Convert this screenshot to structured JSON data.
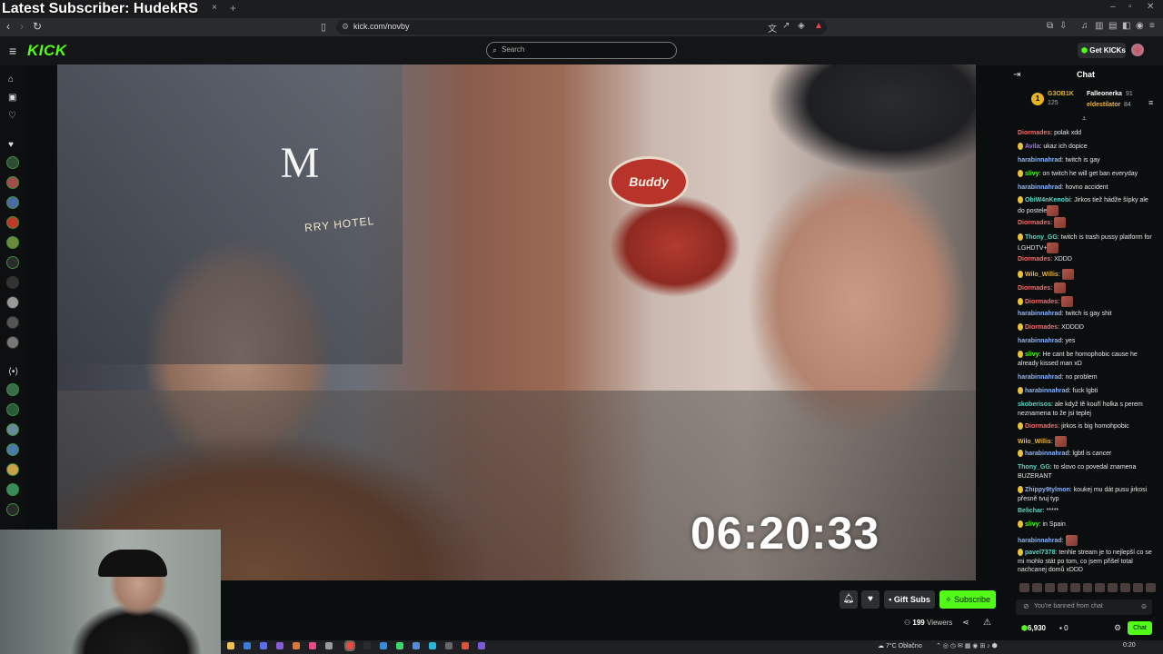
{
  "overlay": {
    "title": "Latest Subscriber: HudekRS"
  },
  "browser": {
    "url": "kick.com/novby",
    "tab_close": "×",
    "tab_new": "+"
  },
  "topnav": {
    "logo": "KICK",
    "search_placeholder": "Search",
    "get_kicks": "Get KICKs"
  },
  "video": {
    "timer": "06:20:33",
    "sign_text": "Buddy",
    "hotel_letter": "M",
    "hotel_name": "RRY HOTEL"
  },
  "controls": {
    "gift_subs": "Gift Subs",
    "subscribe": "Subscribe",
    "viewers_count": "199",
    "viewers_label": "Viewers"
  },
  "chat": {
    "title": "Chat",
    "leaderboard": {
      "rank": "1",
      "first_name": "G3OB1K",
      "first_value": "125",
      "second_name": "Falleonerka",
      "second_value": "91",
      "third_name": "eldestilator",
      "third_value": "84"
    },
    "messages": [
      {
        "user": "Diormades",
        "color": "#ff6b6b",
        "text": "polak xdd",
        "emote": false
      },
      {
        "user": "Avila",
        "color": "#b16cff",
        "text": "ukaz ich dopice",
        "emote": false
      },
      {
        "user": "harabinnahrad",
        "color": "#8ab4f8",
        "text": "twitch is gay",
        "emote": false
      },
      {
        "user": "slivy",
        "color": "#53fc18",
        "text": "on twitch he will get ban everyday",
        "emote": false
      },
      {
        "user": "harabinnahrad",
        "color": "#8ab4f8",
        "text": "hovno accident",
        "emote": false
      },
      {
        "user": "ObiW4nKenobi",
        "color": "#5ad8c7",
        "text": "Jirkos tiež hádže šípky ale do postele",
        "emote": true
      },
      {
        "user": "Diormades",
        "color": "#ff6b6b",
        "text": "",
        "emote": true
      },
      {
        "user": "Thony_GG",
        "color": "#5ad8c7",
        "text": "twitch is trash pussy platform for LGHDTV+",
        "emote": true
      },
      {
        "user": "Diormades",
        "color": "#ff6b6b",
        "text": "XDDD",
        "emote": false
      },
      {
        "user": "Wilo_Willis",
        "color": "#f3b23a",
        "text": "",
        "emote": true
      },
      {
        "user": "Diormades",
        "color": "#ff6b6b",
        "text": "",
        "emote": true
      },
      {
        "user": "Diormades",
        "color": "#ff6b6b",
        "text": "",
        "emote": true
      },
      {
        "user": "harabinnahrad",
        "color": "#8ab4f8",
        "text": "twitch is gay shit",
        "emote": false
      },
      {
        "user": "Diormades",
        "color": "#ff6b6b",
        "text": "XDDDD",
        "emote": false
      },
      {
        "user": "harabinnahrad",
        "color": "#8ab4f8",
        "text": "yes",
        "emote": false
      },
      {
        "user": "slivy",
        "color": "#53fc18",
        "text": "He cant be homophobic cause he already kissed man xD",
        "emote": false
      },
      {
        "user": "harabinnahrad",
        "color": "#8ab4f8",
        "text": "no problem",
        "emote": false
      },
      {
        "user": "harabinnahrad",
        "color": "#8ab4f8",
        "text": "fuck lgbti",
        "emote": false
      },
      {
        "user": "skoberisos",
        "color": "#5ad8c7",
        "text": "ale když tě kouří holka s perem neznamena to že jsi teplej",
        "emote": false
      },
      {
        "user": "Diormades",
        "color": "#ff6b6b",
        "text": "jirkos is big homohpobic",
        "emote": false
      },
      {
        "user": "Wilo_Willis",
        "color": "#f3b23a",
        "text": "",
        "emote": true
      },
      {
        "user": "harabinnahrad",
        "color": "#8ab4f8",
        "text": "lgbtl is cancer",
        "emote": false
      },
      {
        "user": "Thony_GG",
        "color": "#5ad8c7",
        "text": "to slovo co povedal znamena BUZERANT",
        "emote": false
      },
      {
        "user": "Zhippy9tylmon",
        "color": "#8ab4f8",
        "text": "koukej mu dát pusu jirkosi přesně tvuj typ",
        "emote": false
      },
      {
        "user": "Belichar",
        "color": "#5ad8c7",
        "text": "*****",
        "emote": false
      },
      {
        "user": "slivy",
        "color": "#53fc18",
        "text": "in Spain",
        "emote": false
      },
      {
        "user": "harabinnahrad",
        "color": "#8ab4f8",
        "text": "",
        "emote": true
      },
      {
        "user": "pavel7378",
        "color": "#5ad8c7",
        "text": "tenhle stream je to nejlepší co se mi mohlo stát po tom, co jsem přišel total nachcanej domů xDDD",
        "emote": false
      }
    ],
    "input_placeholder": "You're banned from chat",
    "kicks_balance": "6,930",
    "gift_count": "0",
    "send_label": "Chat"
  },
  "taskbar": {
    "weather": "7°C  Oblačno",
    "time": "0:20"
  }
}
